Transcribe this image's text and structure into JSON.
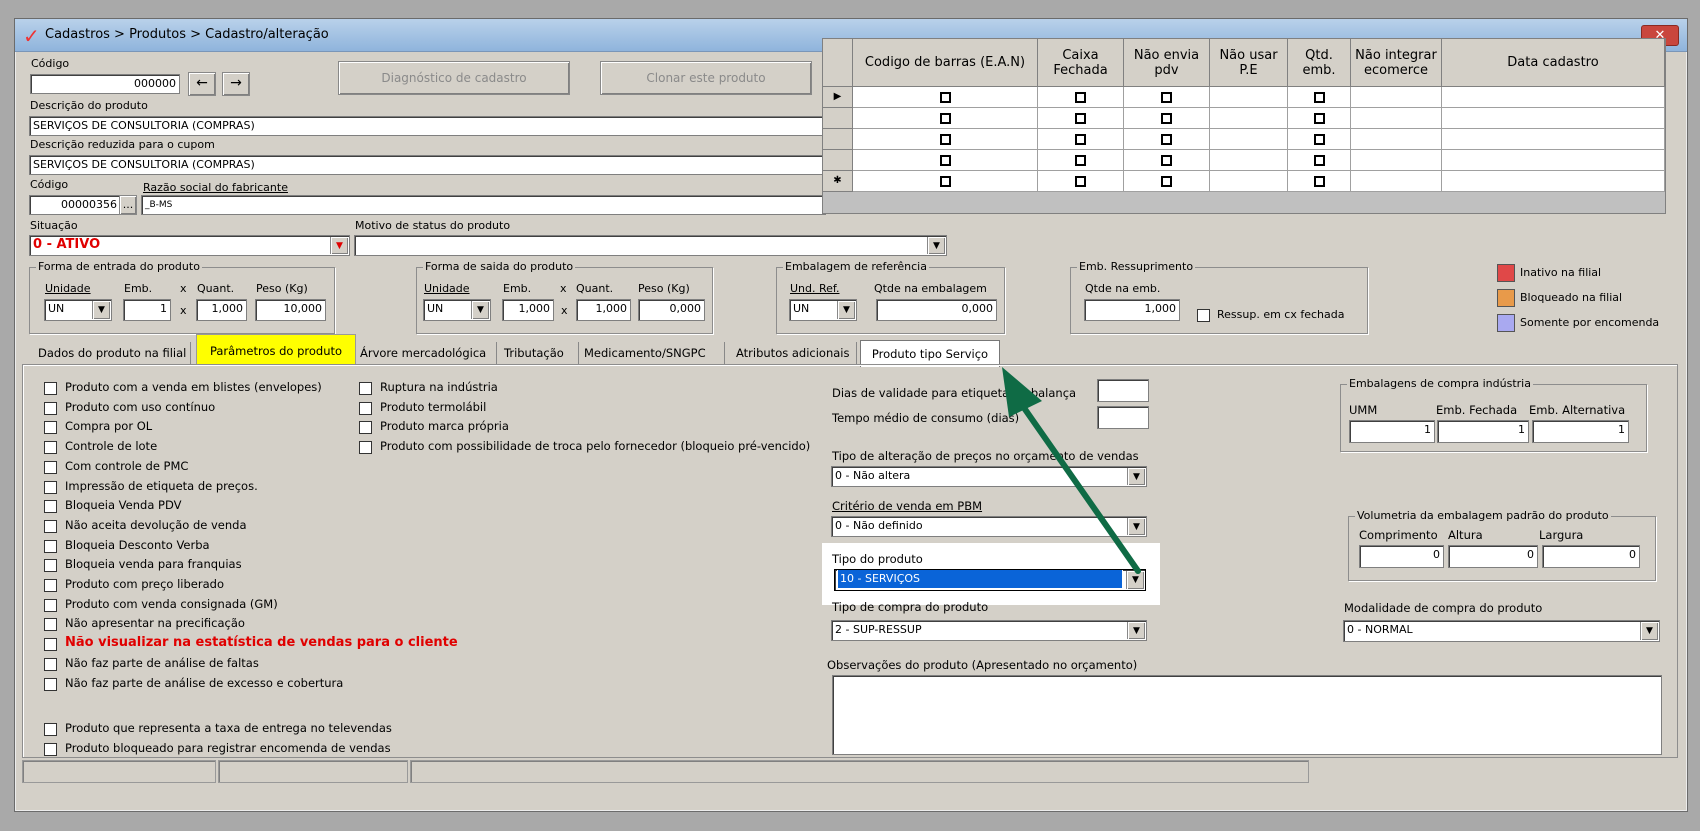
{
  "window": {
    "title": "Cadastros > Produtos > Cadastro/alteração",
    "close": "✕"
  },
  "top": {
    "codigo_label": "Código",
    "codigo_value": "000000",
    "prev_icon": "←",
    "next_icon": "→",
    "diag_button": "Diagnóstico de cadastro",
    "clone_button": "Clonar este produto",
    "descricao_label": "Descrição  do produto",
    "descricao_value": "SERVIÇOS DE CONSULTORIA (COMPRAS)",
    "desc_reduzida_label": "Descrição reduzida para o cupom",
    "desc_reduzida_value": "SERVIÇOS DE CONSULTORIA (COMPRAS)",
    "fab_codigo_label": "Código",
    "fab_codigo_value": "00000356",
    "fab_lookup": "...",
    "razao_label": "Razão social do fabricante",
    "razao_value": "_B-MS",
    "situacao_label": "Situação",
    "situacao_value": "0 - ATIVO",
    "motivo_label": "Motivo de status do produto",
    "motivo_value": ""
  },
  "grid": {
    "headers": [
      "Codigo de barras (E.A.N)",
      "Caixa Fechada",
      "Não envia pdv",
      "Não usar P.E",
      "Qtd. emb.",
      "Não integrar ecomerce",
      "Data cadastro"
    ],
    "row_markers": [
      "▶",
      "",
      "",
      "",
      "✱"
    ]
  },
  "entrada": {
    "title": "Forma de entrada do produto",
    "unidade_label": "Unidade",
    "emb_label": "Emb.",
    "x1": "x",
    "quant_label": "Quant.",
    "peso_label": "Peso (Kg)",
    "unidade": "UN",
    "emb": "1",
    "x2": "x",
    "quant": "1,000",
    "peso": "10,000"
  },
  "saida": {
    "title": "Forma de saida do produto",
    "unidade_label": "Unidade",
    "emb_label": "Emb.",
    "x1": "x",
    "quant_label": "Quant.",
    "peso_label": "Peso (Kg)",
    "unidade": "UN",
    "emb": "1,000",
    "x2": "x",
    "quant": "1,000",
    "peso": "0,000"
  },
  "embalagem_ref": {
    "title": "Embalagem de referência",
    "und_label": "Und. Ref.",
    "qtde_label": "Qtde na embalagem",
    "und": "UN",
    "qtde": "0,000"
  },
  "ressup": {
    "title": "Emb. Ressuprimento",
    "qtde_label": "Qtde na emb.",
    "qtde": "1,000",
    "check_label": "Ressup. em cx fechada"
  },
  "legend": [
    {
      "label": "Inativo na filial",
      "color": "#e04848"
    },
    {
      "label": "Bloqueado na filial",
      "color": "#e89a4a"
    },
    {
      "label": "Somente por encomenda",
      "color": "#a9a9f0"
    }
  ],
  "tabs": [
    "Dados do produto na filial",
    "Parâmetros do produto",
    "Árvore mercadológica",
    "Tributação",
    "Medicamento/SNGPC",
    "Atributos adicionais",
    "Produto tipo Serviço"
  ],
  "checks_col1": [
    "Produto com a venda em blistes (envelopes)",
    "Produto com uso contínuo",
    "Compra por OL",
    "Controle de lote",
    "Com controle de PMC",
    "Impressão de etiqueta de preços.",
    "Bloqueia Venda PDV",
    "Não aceita devolução de venda",
    "Bloqueia Desconto Verba",
    "Bloqueia venda para franquias",
    "Produto com preço liberado",
    "Produto com venda consignada (GM)",
    "Não apresentar na precificação",
    "Não visualizar na estatística de vendas para o cliente",
    "Não faz parte de análise de faltas",
    "Não faz parte de análise de excesso e cobertura"
  ],
  "checks_col1b": [
    "Produto que representa a taxa de entrega no televendas",
    "Produto bloqueado para registrar encomenda de vendas"
  ],
  "checks_col2": [
    "Ruptura na indústria",
    "Produto termolábil",
    "Produto marca própria",
    "Produto com possibilidade de troca pelo fornecedor (bloqueio pré-vencido)"
  ],
  "middle": {
    "dias_validade_label": "Dias de validade para etiqueta da balança",
    "tempo_medio_label": "Tempo médio de consumo (dias)",
    "tipo_alteracao_label": "Tipo de alteração de preços no orçamento de vendas",
    "tipo_alteracao_value": "0 - Não altera",
    "criterio_label": "Critério de venda em PBM",
    "criterio_value": "0 - Não definido",
    "tipo_produto_label": "Tipo do produto",
    "tipo_produto_value": "10 - SERVIÇOS",
    "tipo_compra_label": "Tipo de compra do produto",
    "tipo_compra_value": "2 - SUP-RESSUP",
    "observacoes_label": "Observações do produto (Apresentado no orçamento)"
  },
  "emb_compra": {
    "title": "Embalagens de compra indústria",
    "umm_label": "UMM",
    "fechada_label": "Emb. Fechada",
    "alt_label": "Emb. Alternativa",
    "umm": "1",
    "fechada": "1",
    "alt": "1"
  },
  "volumetria": {
    "title": "Volumetria da embalagem padrão do produto",
    "comp_label": "Comprimento",
    "alt_label": "Altura",
    "larg_label": "Largura",
    "comp": "0",
    "alt": "0",
    "larg": "0"
  },
  "modalidade": {
    "label": "Modalidade de compra do produto",
    "value": "0 - NORMAL"
  },
  "colors": {
    "highlight_tab": "#ffff00",
    "selected": "#0a64d8",
    "arrow": "#0f6b45",
    "alert_text": "#e00000"
  }
}
